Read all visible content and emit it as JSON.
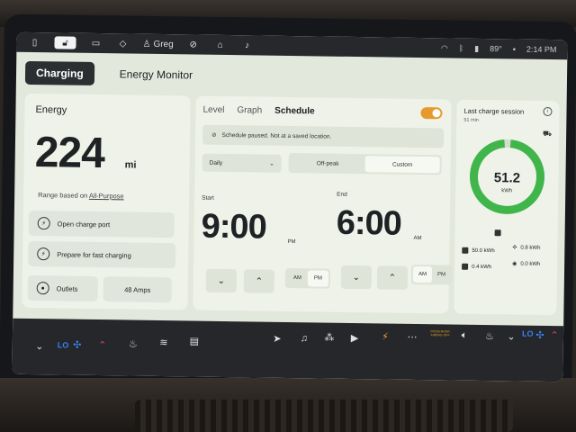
{
  "status_bar": {
    "user": "Greg",
    "temperature": "89°",
    "time": "2:14 PM"
  },
  "tabs": [
    "Charging",
    "Energy Monitor"
  ],
  "energy": {
    "title": "Energy",
    "range_value": "224",
    "range_unit": "mi",
    "range_basis_prefix": "Range based on",
    "range_basis_link": "All-Purpose",
    "open_port_label": "Open charge port",
    "fast_charge_label": "Prepare for fast charging",
    "outlets_label": "Outlets",
    "amps_label": "48 Amps"
  },
  "schedule": {
    "tabs": [
      "Level",
      "Graph",
      "Schedule"
    ],
    "active_tab": "Schedule",
    "enabled": true,
    "notice": "Schedule paused. Not at a saved location.",
    "frequency": "Daily",
    "rate_options": [
      "Off-peak",
      "Custom"
    ],
    "rate_selected": "Custom",
    "start_label": "Start",
    "start_time": "9:00",
    "start_suffix": "PM",
    "end_label": "End",
    "end_time": "6:00",
    "end_suffix": "AM",
    "ampm_options": [
      "AM",
      "PM"
    ]
  },
  "session": {
    "title": "Last charge session",
    "duration": "51 min",
    "energy_value": "51.2",
    "energy_unit": "kWh",
    "fill_fraction": 0.97,
    "stats": {
      "grid": "50.0 kWh",
      "climate": "0.8 kWh",
      "drive": "0.4 kWh",
      "other": "0.0 kWh"
    }
  },
  "bottom_bar": {
    "left_fan_label": "LO",
    "right_fan_label": "LO",
    "passenger_airbag": "PASSENGER AIRBAG OFF"
  },
  "colors": {
    "accent_orange": "#e69a2e",
    "ring_green": "#3fb54a",
    "ring_track": "#d5dcce",
    "fan_blue": "#3b82f6"
  }
}
